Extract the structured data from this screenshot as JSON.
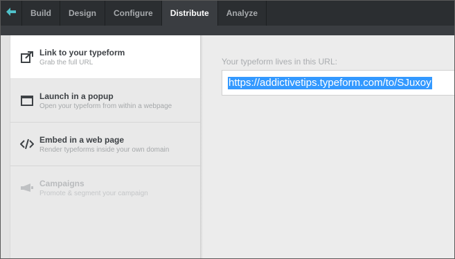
{
  "nav": {
    "back_icon": "back-arrow-icon",
    "tabs": [
      {
        "label": "Build",
        "active": false
      },
      {
        "label": "Design",
        "active": false
      },
      {
        "label": "Configure",
        "active": false
      },
      {
        "label": "Distribute",
        "active": true
      },
      {
        "label": "Analyze",
        "active": false
      }
    ]
  },
  "sidebar": {
    "items": [
      {
        "icon": "external-link-icon",
        "title": "Link to your typeform",
        "subtitle": "Grab the full URL",
        "active": true
      },
      {
        "icon": "popup-window-icon",
        "title": "Launch in a popup",
        "subtitle": "Open your typeform from within a webpage",
        "active": false
      },
      {
        "icon": "code-embed-icon",
        "title": "Embed in a web page",
        "subtitle": "Render typeforms inside your own domain",
        "active": false
      },
      {
        "icon": "megaphone-icon",
        "title": "Campaigns",
        "subtitle": "Promote & segment your campaign",
        "active": false,
        "disabled": true
      }
    ]
  },
  "main": {
    "url_label": "Your typeform lives in this URL:",
    "url_value": "https://addictivetips.typeform.com/to/SJuxoy"
  },
  "colors": {
    "topbar": "#2b2e31",
    "active_tab": "#3a3d41",
    "accent_back": "#4fc1c9",
    "selection": "#3399ff"
  }
}
